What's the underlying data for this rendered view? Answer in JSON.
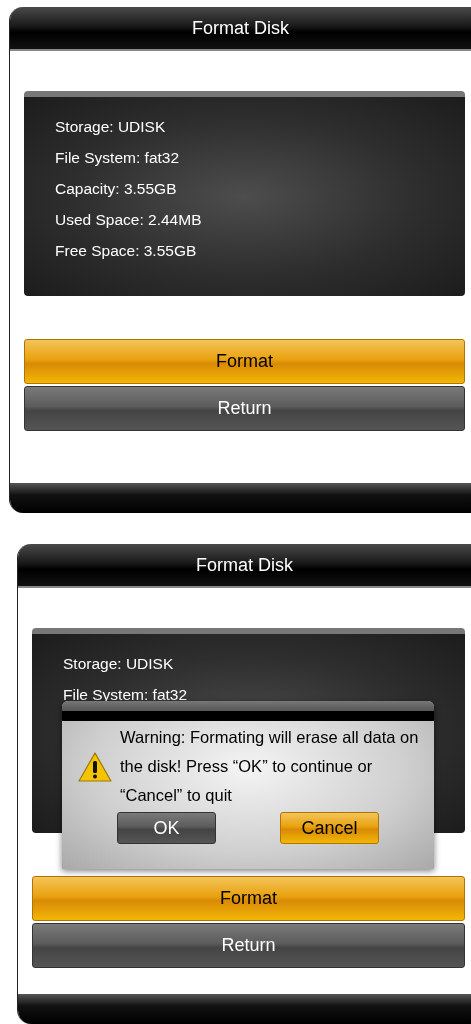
{
  "screens": [
    {
      "title": "Format Disk",
      "info_lines": [
        "Storage: UDISK",
        "File System: fat32",
        "Capacity: 3.55GB",
        "Used Space: 2.44MB",
        "Free Space: 3.55GB"
      ],
      "buttons": [
        {
          "label": "Format",
          "selected": true
        },
        {
          "label": "Return",
          "selected": false
        }
      ]
    },
    {
      "title": "Format Disk",
      "info_lines": [
        "Storage: UDISK",
        "File System: fat32"
      ],
      "buttons": [
        {
          "label": "Format",
          "selected": true
        },
        {
          "label": "Return",
          "selected": false
        }
      ],
      "dialog": {
        "message": "Warning: Formating will erase all data on the disk! Press “OK” to continue or “Cancel” to quit",
        "buttons": [
          {
            "label": "OK",
            "selected": false
          },
          {
            "label": "Cancel",
            "selected": true
          }
        ]
      }
    }
  ]
}
